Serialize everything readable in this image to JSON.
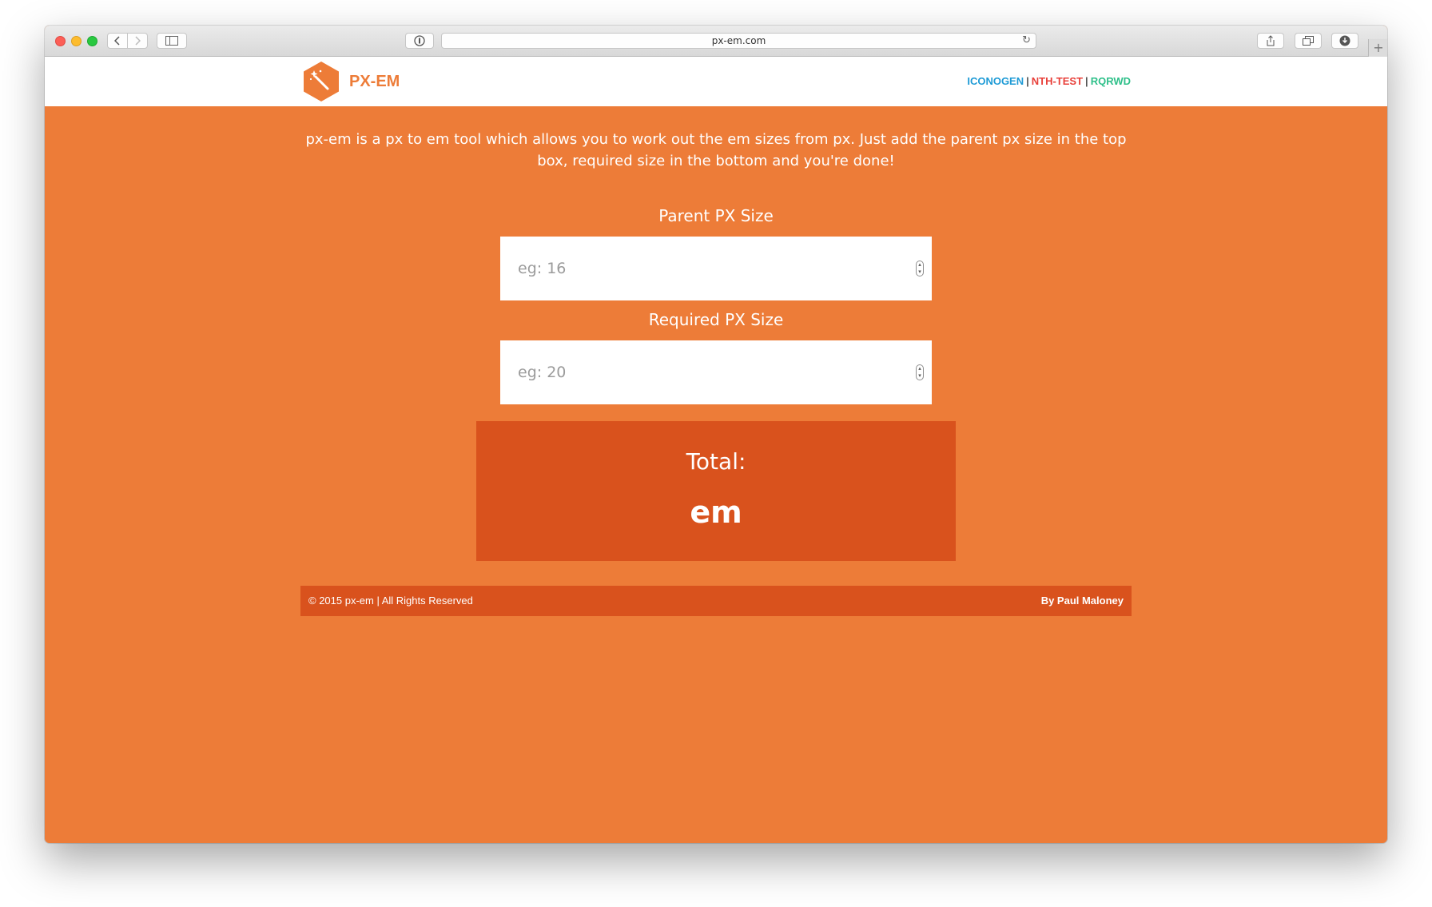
{
  "browser": {
    "url": "px-em.com",
    "back_icon": "chevron-left-icon",
    "forward_icon": "chevron-right-icon",
    "reload_icon": "reload-icon",
    "new_tab_label": "+"
  },
  "header": {
    "logo_text": "PX-EM",
    "links": [
      {
        "label": "ICONOGEN",
        "color": "#1f9bd6"
      },
      {
        "label": "NTH-TEST",
        "color": "#e8403a"
      },
      {
        "label": "RQRWD",
        "color": "#2fc08a"
      }
    ],
    "separator": "|"
  },
  "main": {
    "intro": "px-em is a px to em tool which allows you to work out the em sizes from px. Just add the parent px size in the top box, required size in the bottom and you're done!",
    "parent": {
      "label": "Parent PX Size",
      "placeholder": "eg: 16",
      "value": ""
    },
    "required": {
      "label": "Required PX Size",
      "placeholder": "eg: 20",
      "value": ""
    },
    "total": {
      "label": "Total:",
      "value": "em"
    }
  },
  "footer": {
    "copyright": "© 2015 px-em | All Rights Reserved",
    "credit": "By Paul Maloney"
  },
  "colors": {
    "accent": "#ed7c38",
    "dark_accent": "#d9521d"
  }
}
